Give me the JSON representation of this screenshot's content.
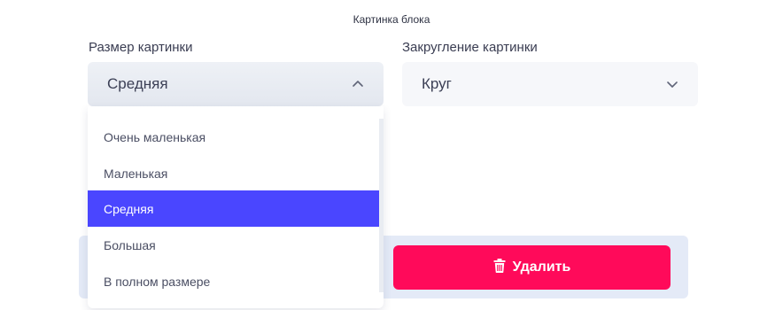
{
  "section_title": "Картинка блока",
  "size_field": {
    "label": "Размер картинки",
    "selected_value": "Средняя",
    "options": [
      "Очень маленькая",
      "Маленькая",
      "Средняя",
      "Большая",
      "В полном размере"
    ],
    "selected_index": 2
  },
  "rounding_field": {
    "label": "Закругление картинки",
    "selected_value": "Круг"
  },
  "actions": {
    "delete_label": "Удалить"
  },
  "colors": {
    "accent": "#4a46ff",
    "danger": "#ff0a5a",
    "action_bar_bg": "#e4eaf7"
  },
  "icons": {
    "select_chevron": "chevron-down-icon",
    "delete": "trash-icon"
  }
}
